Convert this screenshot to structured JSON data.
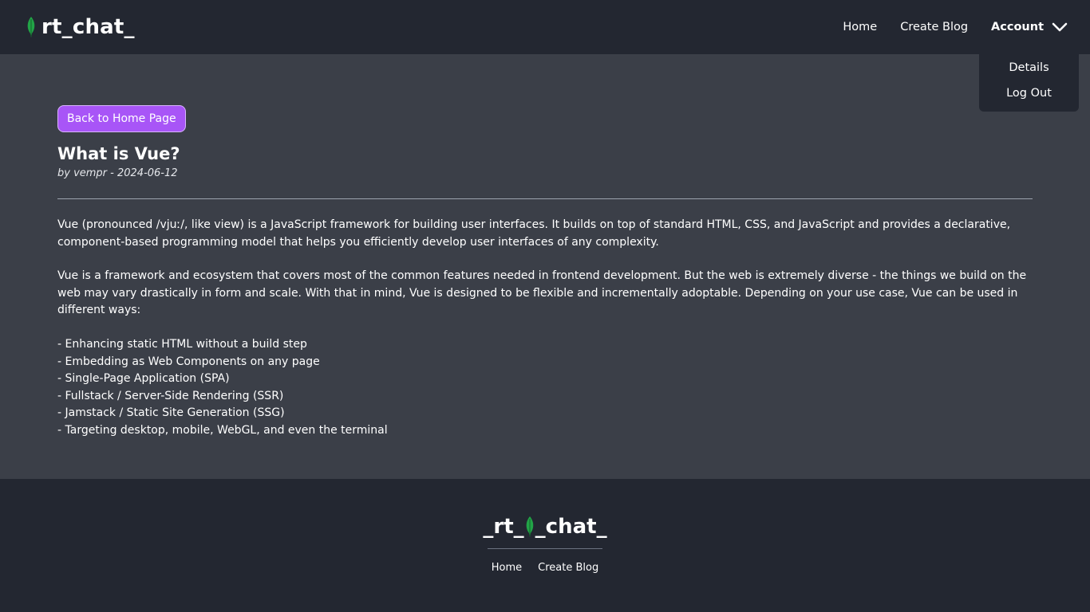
{
  "navbar": {
    "brand": "rt_chat_",
    "links": {
      "home": "Home",
      "create_blog": "Create Blog",
      "account": "Account"
    },
    "account_menu": {
      "details": "Details",
      "logout": "Log Out"
    }
  },
  "post": {
    "back_button": "Back to Home Page",
    "title": "What is Vue?",
    "byline": "by vempr - 2024-06-12",
    "paragraph1": "Vue (pronounced /vjuː/, like view) is a JavaScript framework for building user interfaces. It builds on top of standard HTML, CSS, and JavaScript and provides a declarative, component-based programming model that helps you efficiently develop user interfaces of any complexity.",
    "paragraph2": "Vue is a framework and ecosystem that covers most of the common features needed in frontend development. But the web is extremely diverse - the things we build on the web may vary drastically in form and scale. With that in mind, Vue is designed to be flexible and incrementally adoptable. Depending on your use case, Vue can be used in different ways:",
    "list": [
      "- Enhancing static HTML without a build step",
      "- Embedding as Web Components on any page",
      "- Single-Page Application (SPA)",
      "- Fullstack / Server-Side Rendering (SSR)",
      "- Jamstack / Static Site Generation (SSG)",
      "- Targeting desktop, mobile, WebGL, and even the terminal"
    ]
  },
  "footer": {
    "brand_left": "_rt_",
    "brand_right": "_chat_",
    "links": {
      "home": "Home",
      "create_blog": "Create Blog"
    }
  },
  "icons": {
    "brand": "leaf-icon",
    "dropdown": "chevron-down-icon"
  },
  "colors": {
    "accent": "#a855f7",
    "leaf": "#22a447",
    "navbar": "#232731",
    "background": "#3b3f48"
  }
}
